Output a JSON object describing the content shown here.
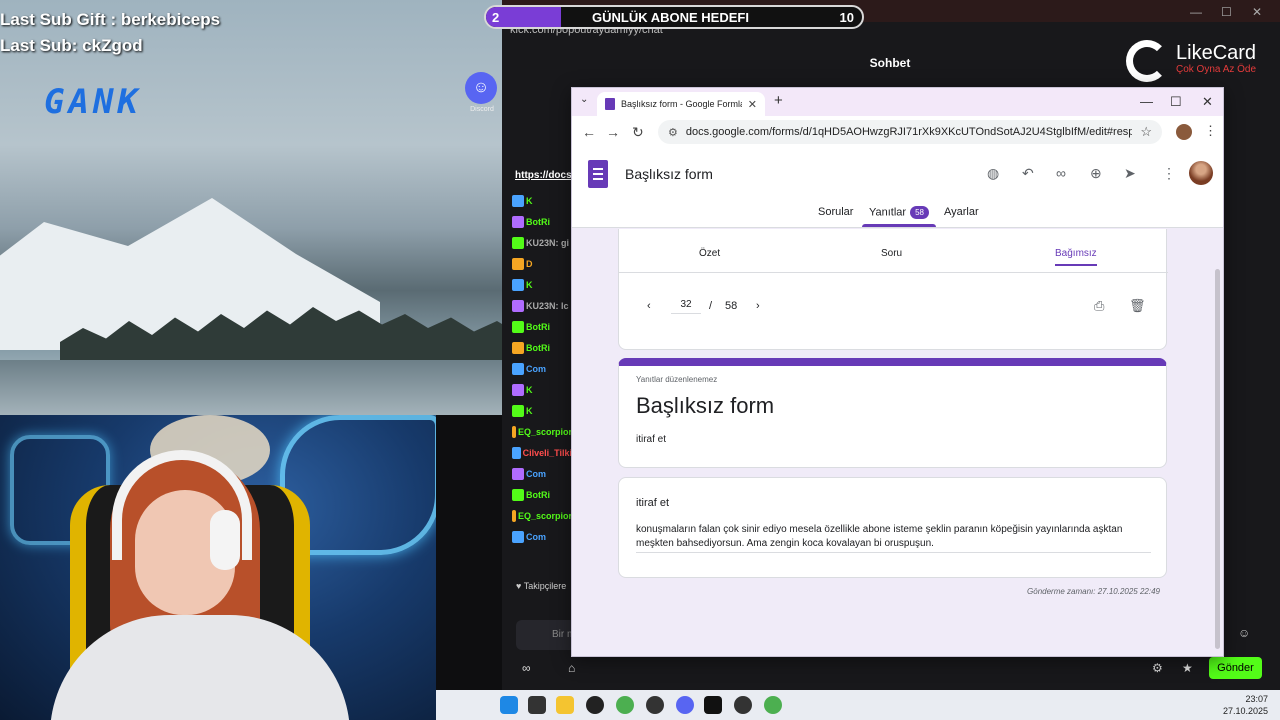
{
  "stream_overlay": {
    "last_sub_gift": "Last Sub Gift : berkebiceps",
    "last_sub": "Last Sub: ckZgod",
    "logo": "GANK",
    "discord_label": "Discord",
    "discord_icon": "discord-icon"
  },
  "sub_goal": {
    "current": "2",
    "title": "GÜNLÜK ABONE HEDEFI",
    "target": "10",
    "progress_fraction": 0.2,
    "fill_color": "#7a3dd6"
  },
  "kick_chat": {
    "popout_url": "kick.com/popout/aydamiyy/chat",
    "title": "Sohbet",
    "pinned_link": "https://docs",
    "rows": [
      {
        "name": "K",
        "color": "#53fc18"
      },
      {
        "name": "BotRi",
        "color": "#53fc18"
      },
      {
        "name": "KU23N: gi",
        "color": "#aaaaaa"
      },
      {
        "name": "D",
        "color": "#f5a623"
      },
      {
        "name": "K",
        "color": "#53fc18"
      },
      {
        "name": "KU23N: lc",
        "color": "#aaaaaa"
      },
      {
        "name": "BotRi",
        "color": "#53fc18"
      },
      {
        "name": "BotRi",
        "color": "#53fc18"
      },
      {
        "name": "Com",
        "color": "#4aa3ff"
      },
      {
        "name": "K",
        "color": "#53fc18"
      },
      {
        "name": "K",
        "color": "#53fc18"
      },
      {
        "name": "EQ_scorpior",
        "color": "#53fc18"
      },
      {
        "name": "Cilveli_Tilki",
        "color": "#ff4d4d"
      },
      {
        "name": "Com",
        "color": "#4aa3ff"
      },
      {
        "name": "BotRi",
        "color": "#53fc18"
      },
      {
        "name": "EQ_scorpior",
        "color": "#53fc18"
      },
      {
        "name": "Com",
        "color": "#4aa3ff"
      }
    ],
    "followers_label": "Takipçilere",
    "input_placeholder": "Bir m",
    "send_label": "Gönder",
    "accent": "#53fc18"
  },
  "likecard": {
    "name": "LikeCard",
    "tagline": "Çok Oyna  Az Öde"
  },
  "chrome": {
    "tab_title": "Başlıksız form - Google Formlar",
    "url": "docs.google.com/forms/d/1qHD5AOHwzgRJI71rXk9XKcUTOndSotAJ2U4StglbIfM/edit#response=A...",
    "icons": {
      "back": "arrow-back-icon",
      "forward": "arrow-forward-icon",
      "reload": "reload-icon",
      "star": "star-icon",
      "menu": "kebab-menu-icon"
    }
  },
  "forms": {
    "title": "Başlıksız form",
    "tabs": {
      "questions": "Sorular",
      "responses": "Yanıtlar",
      "responses_count": "58",
      "settings": "Ayarlar"
    },
    "subtabs": {
      "summary": "Özet",
      "question": "Soru",
      "individual": "Bağımsız"
    },
    "pager": {
      "current": "32",
      "separator": "/",
      "total": "58"
    },
    "not_editable": "Yanıtlar düzenlenemez",
    "form_title": "Başlıksız form",
    "form_description": "itiraf et",
    "question_label": "itiraf et",
    "answer": "konuşmaların falan çok sinir ediyo mesela özellikle abone isteme şeklin paranın köpeğisin yayınlarında aşktan meşkten bahsediyorsun. Ama zengin koca kovalayan bi oruspuşun.",
    "submitted_at": "Gönderme zamanı: 27.10.2025 22:49",
    "accent": "#673ab7"
  },
  "taskbar": {
    "time": "23:07",
    "date": "27.10.2025"
  }
}
